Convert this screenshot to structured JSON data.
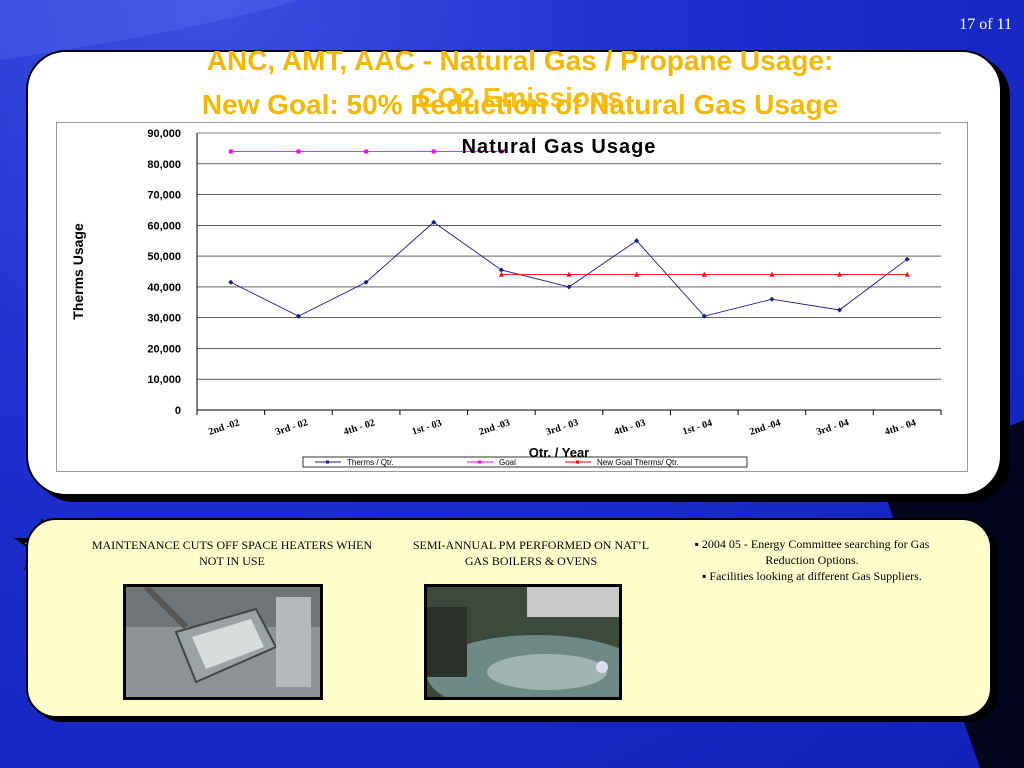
{
  "slide": {
    "page_number": "17 of 11",
    "title_line1": "ANC, AMT, AAC - Natural Gas / Propane Usage:",
    "title_line2": "New Goal: 50% Reduction of Natural Gas Usage",
    "title_overlay": "CO2 Emissions"
  },
  "chart_data": {
    "type": "line",
    "title": "Natural Gas Usage",
    "xlabel": "Qtr. / Year",
    "ylabel": "Therms Usage",
    "ylim": [
      0,
      90000
    ],
    "yticks": [
      "0",
      "10,000",
      "20,000",
      "30,000",
      "40,000",
      "50,000",
      "60,000",
      "70,000",
      "80,000",
      "90,000"
    ],
    "categories": [
      "2nd -02",
      "3rd - 02",
      "4th - 02",
      "1st - 03",
      "2nd -03",
      "3rd - 03",
      "4th - 03",
      "1st - 04",
      "2nd -04",
      "3rd - 04",
      "4th - 04"
    ],
    "grid": true,
    "legend_position": "bottom",
    "series": [
      {
        "name": "Therms / Qtr.",
        "color": "#1a1a8c",
        "marker": "diamond",
        "values": [
          41500,
          30500,
          41500,
          61000,
          45500,
          40000,
          55000,
          30500,
          36000,
          32500,
          49000
        ]
      },
      {
        "name": "Goal",
        "color": "#ff00ff",
        "marker": "square",
        "values": [
          84000,
          84000,
          84000,
          84000,
          84000,
          null,
          null,
          null,
          null,
          null,
          null
        ]
      },
      {
        "name": "New Goal Therms/ Qtr.",
        "color": "#ff0000",
        "marker": "triangle",
        "values": [
          null,
          null,
          null,
          null,
          44000,
          44000,
          44000,
          44000,
          44000,
          44000,
          44000
        ]
      }
    ]
  },
  "bottom": {
    "caption1": "MAINTENANCE CUTS OFF SPACE HEATERS WHEN NOT IN USE",
    "caption2": "SEMI-ANNUAL PM PERFORMED ON NAT’L GAS BOILERS & OVENS",
    "notes": [
      "▪ 2004  05 - Energy Committee searching for Gas Reduction Options.",
      "▪ Facilities looking at different Gas Suppliers."
    ]
  }
}
